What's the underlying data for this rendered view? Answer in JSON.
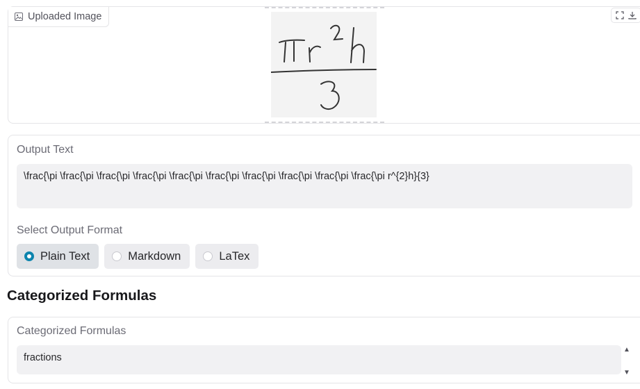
{
  "image_panel": {
    "label": "Uploaded Image",
    "formula_image": {
      "numerator": "πr²h",
      "denominator": "3"
    },
    "tools": [
      "fullscreen-icon",
      "download-icon"
    ]
  },
  "output_panel": {
    "label": "Output Text",
    "value": "\\frac{\\pi \\frac{\\pi \\frac{\\pi \\frac{\\pi \\frac{\\pi \\frac{\\pi \\frac{\\pi \\frac{\\pi \\frac{\\pi \\frac{\\pi r^{2}h}{3}",
    "format_label": "Select Output Format",
    "formats": [
      {
        "label": "Plain Text",
        "selected": true
      },
      {
        "label": "Markdown",
        "selected": false
      },
      {
        "label": "LaTex",
        "selected": false
      }
    ]
  },
  "categorized": {
    "section_title": "Categorized Formulas",
    "field_label": "Categorized Formulas",
    "value": "fractions"
  },
  "colors": {
    "accent": "#0c84ad",
    "panel_border": "#e4e4e7",
    "field_bg": "#f1f1f3"
  }
}
